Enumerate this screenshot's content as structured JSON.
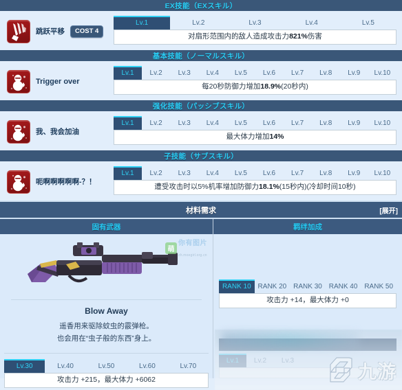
{
  "sections": [
    {
      "header": "EX技能（EXスキル）",
      "skill": {
        "icon": "claw-slash-icon",
        "name": "跳跃平移",
        "cost": "COST 4",
        "tabs": [
          "Lv.1",
          "Lv.2",
          "Lv.3",
          "Lv.4",
          "Lv.5"
        ],
        "active_tab": 0,
        "desc_prefix": "对扇形范围内的敌人造成攻击力",
        "desc_value": "821%",
        "desc_suffix": "伤害"
      }
    },
    {
      "header": "基本技能（ノーマルスキル）",
      "skill": {
        "icon": "snowman-icon",
        "name": "Trigger over",
        "cost": "",
        "tabs": [
          "Lv.1",
          "Lv.2",
          "Lv.3",
          "Lv.4",
          "Lv.5",
          "Lv.6",
          "Lv.7",
          "Lv.8",
          "Lv.9",
          "Lv.10"
        ],
        "active_tab": 0,
        "desc_prefix": "每20秒防御力增加",
        "desc_value": "18.9%",
        "desc_suffix": "(20秒内)"
      }
    },
    {
      "header": "强化技能（パッシブスキル）",
      "skill": {
        "icon": "snowman-icon",
        "name": "我、我会加油",
        "cost": "",
        "tabs": [
          "Lv.1",
          "Lv.2",
          "Lv.3",
          "Lv.4",
          "Lv.5",
          "Lv.6",
          "Lv.7",
          "Lv.8",
          "Lv.9",
          "Lv.10"
        ],
        "active_tab": 0,
        "desc_prefix": "最大体力增加",
        "desc_value": "14%",
        "desc_suffix": ""
      }
    },
    {
      "header": "子技能（サブスキル）",
      "skill": {
        "icon": "snowman-icon",
        "name": "呃啊啊啊啊啊-？！",
        "cost": "",
        "tabs": [
          "Lv.1",
          "Lv.2",
          "Lv.3",
          "Lv.4",
          "Lv.5",
          "Lv.6",
          "Lv.7",
          "Lv.8",
          "Lv.9",
          "Lv.10"
        ],
        "active_tab": 0,
        "desc_prefix": "遭受攻击时以5%机率增加防御力",
        "desc_value": "18.1%",
        "desc_suffix": "(15秒内)(冷却时间10秒)"
      }
    }
  ],
  "material": {
    "title": "材料需求",
    "expand_label": "[展开]"
  },
  "weapon": {
    "column_title": "固有武器",
    "name": "Blow Away",
    "flavor_line1": "遥香用来驱除蚊虫的霰弹枪。",
    "flavor_line2": "也会用在“虫子般的东西”身上。",
    "tabs": [
      "Lv.30",
      "Lv.40",
      "Lv.50",
      "Lv.60",
      "Lv.70"
    ],
    "active_tab": 0,
    "stats": "攻击力 +215，最大体力 +6062"
  },
  "bond": {
    "column_title": "羁绊加成",
    "rank_tabs": [
      "RANK 10",
      "RANK 20",
      "RANK 30",
      "RANK 40",
      "RANK 50"
    ],
    "active_rank_tab": 0,
    "stats": "攻击力 +14，最大体力 +0",
    "lower_tabs": [
      "Lv.1",
      "Lv.2",
      "Lv.3"
    ],
    "active_lower_tab": 0
  },
  "watermarks": {
    "moe_badge": "萌",
    "moe_text": "你有图片",
    "moe_url": "zh.moegirl.org.cn",
    "nine_game": "九游"
  },
  "colors": {
    "accent_cyan": "#29cdf5",
    "header_navy": "#3a5778",
    "panel_blue": "#e2eefb",
    "icon_red": "#a81a1c"
  }
}
